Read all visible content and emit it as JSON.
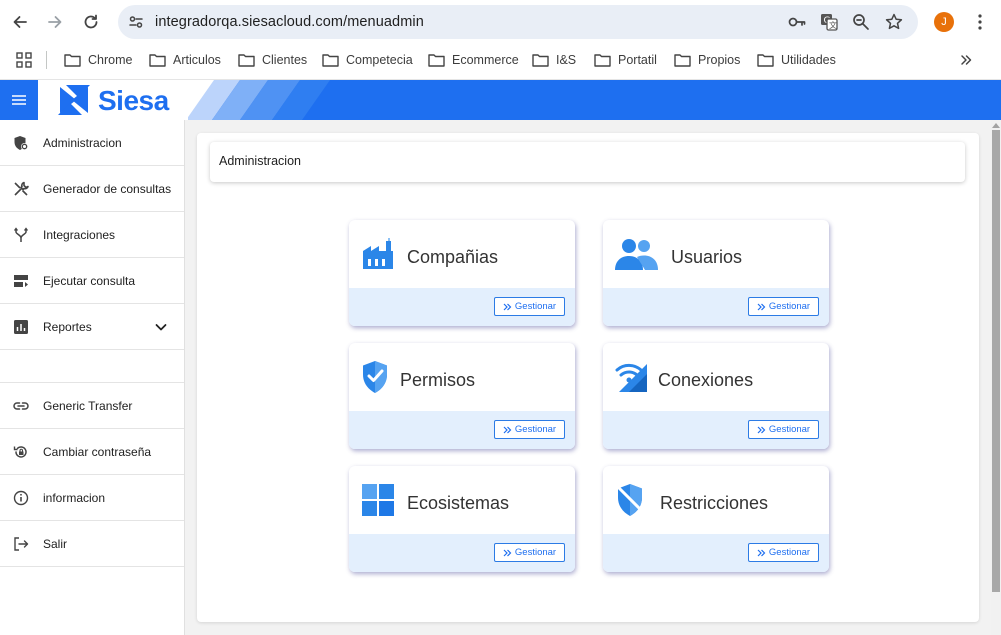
{
  "browser": {
    "url": "integradorqa.siesacloud.com/menuadmin",
    "profile_initial": "J",
    "bookmarks": [
      "Chrome",
      "Articulos",
      "Clientes",
      "Competecia",
      "Ecommerce",
      "I&S",
      "Portatil",
      "Propios",
      "Utilidades"
    ]
  },
  "header": {
    "logo_text": "Siesa",
    "brand_color": "#1e6ff0"
  },
  "sidebar": {
    "items": [
      {
        "label": "Administracion",
        "icon": "shield-gear-icon"
      },
      {
        "label": "Generador de consultas",
        "icon": "tools-icon"
      },
      {
        "label": "Integraciones",
        "icon": "merge-icon"
      },
      {
        "label": "Ejecutar consulta",
        "icon": "query-icon"
      },
      {
        "label": "Reportes",
        "icon": "chart-icon"
      },
      {
        "label": "Generic Transfer",
        "icon": "link-icon"
      },
      {
        "label": "Cambiar contraseña",
        "icon": "lock-reset-icon"
      },
      {
        "label": "informacion",
        "icon": "info-icon"
      },
      {
        "label": "Salir",
        "icon": "logout-icon"
      }
    ]
  },
  "main": {
    "title": "Administracion",
    "button_label": "Gestionar",
    "cards": [
      {
        "title": "Compañias",
        "icon": "factory-icon"
      },
      {
        "title": "Usuarios",
        "icon": "users-icon"
      },
      {
        "title": "Permisos",
        "icon": "shield-check-icon"
      },
      {
        "title": "Conexiones",
        "icon": "signal-icon"
      },
      {
        "title": "Ecosistemas",
        "icon": "windows-icon"
      },
      {
        "title": "Restricciones",
        "icon": "shield-off-icon"
      }
    ]
  }
}
